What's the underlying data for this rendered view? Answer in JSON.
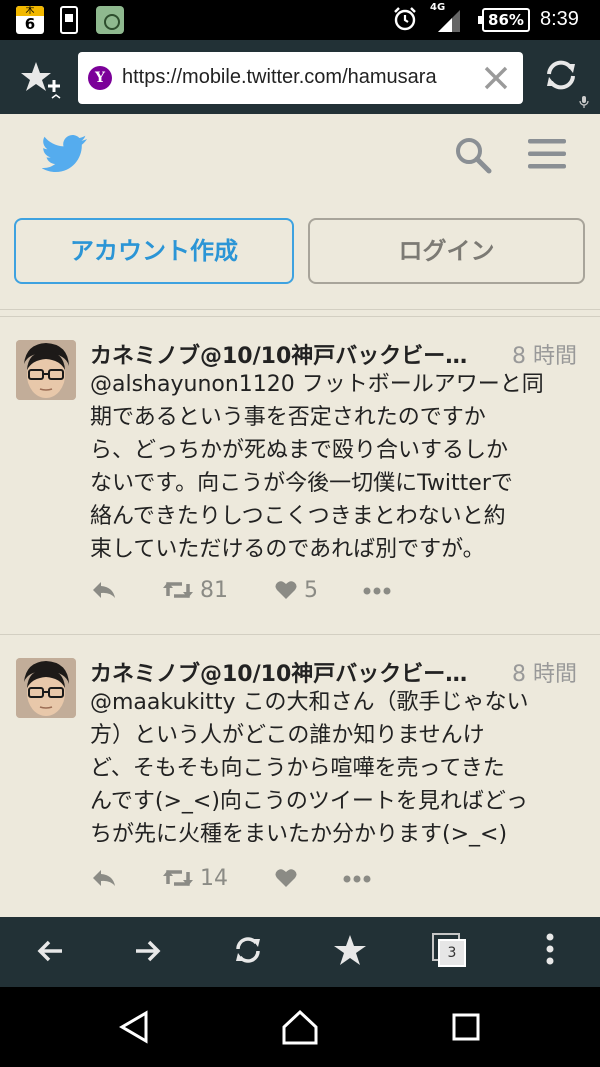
{
  "status_bar": {
    "calendar_day_label": "木",
    "calendar_day_number": "6",
    "network": "4G",
    "battery": "86%",
    "time": "8:39"
  },
  "browser": {
    "url": "https://mobile.twitter.com/hamusara",
    "favicon_letter": "Y",
    "tab_count": "3"
  },
  "header": {
    "signup_label": "アカウント作成",
    "login_label": "ログイン"
  },
  "tweets": [
    {
      "name": "カネミノブ@10/10神戸バックビー…",
      "time": "8 時間",
      "lines": [
        "@alshayunon1120 フットボールアワーと同",
        "期であるという事を否定されたのですか",
        "ら、どっちかが死ぬまで殴り合いするしか",
        "ないです。向こうが今後一切僕にTwitterで",
        "絡んできたりしつこくつきまとわないと約",
        "束していただけるのであれば別ですが。"
      ],
      "retweets": "81",
      "likes": "5"
    },
    {
      "name": "カネミノブ@10/10神戸バックビー…",
      "time": "8 時間",
      "lines": [
        "@maakukitty この大和さん（歌手じゃない",
        "方）という人がどこの誰か知りませんけ",
        "ど、そもそも向こうから喧嘩を売ってきた",
        "んです(>_<)向こうのツイートを見ればどっ",
        "ちが先に火種をまいたか分かります(>_<)"
      ],
      "retweets": "14",
      "likes": ""
    }
  ],
  "colors": {
    "twitter_blue": "#55acee",
    "background": "#ede9dc",
    "toolbar": "#223136"
  }
}
